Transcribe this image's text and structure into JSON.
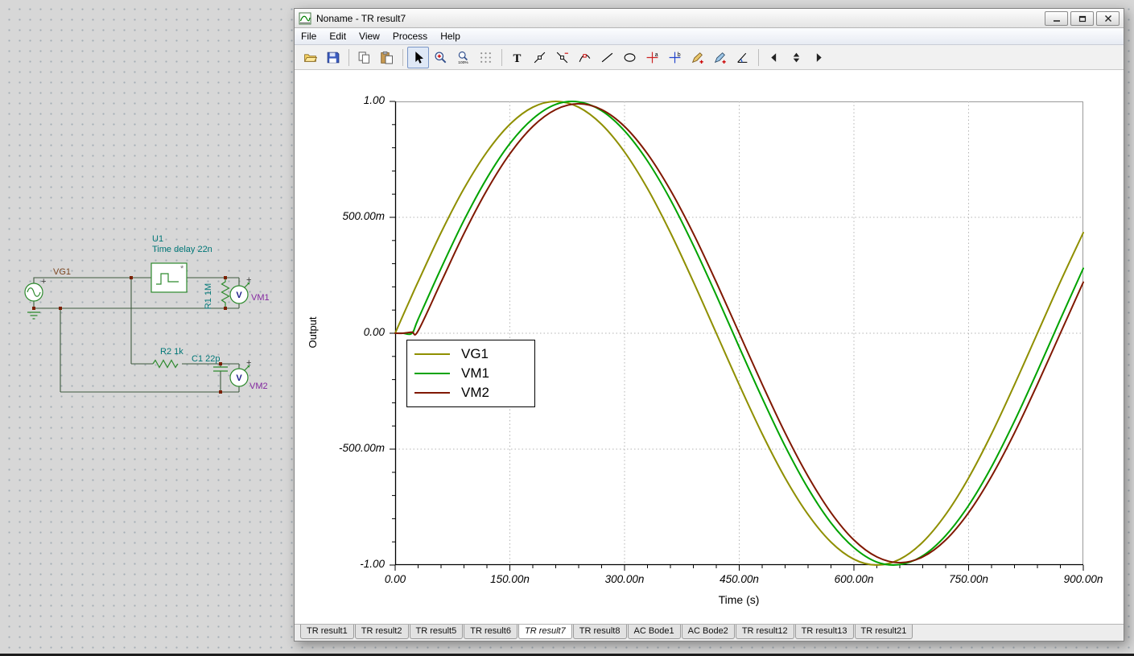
{
  "desktop": {
    "bg_color": "#d7d7d7",
    "grid_dot_color": "#a3adb5"
  },
  "schematic": {
    "wire_color": "#3e5a3e",
    "component_color": "#2d8a2d",
    "labels": {
      "vg1": "VG1",
      "u1_ref": "U1",
      "u1_value": "Time delay 22n",
      "r1": "R1 1M",
      "vm1": "VM1",
      "r2": "R2 1k",
      "c1": "C1 22p",
      "vm2": "VM2",
      "meter_symbol": "V"
    }
  },
  "window": {
    "title": "Noname - TR result7",
    "menu": {
      "items": [
        "File",
        "Edit",
        "View",
        "Process",
        "Help"
      ]
    },
    "toolbar": {
      "buttons": [
        {
          "icon": "open-folder-icon",
          "name": "open"
        },
        {
          "icon": "save-icon",
          "name": "save"
        },
        {
          "sep": true
        },
        {
          "icon": "copy-icon",
          "name": "copy"
        },
        {
          "icon": "paste-icon",
          "name": "paste"
        },
        {
          "sep": true
        },
        {
          "icon": "cursor-icon",
          "name": "select-cursor",
          "active": true
        },
        {
          "icon": "zoom-in-icon",
          "name": "zoom-in"
        },
        {
          "icon": "zoom-100-icon",
          "name": "zoom-100"
        },
        {
          "icon": "grid-icon",
          "name": "toggle-grid"
        },
        {
          "sep": true
        },
        {
          "icon": "text-icon",
          "name": "insert-text"
        },
        {
          "icon": "tangent-icon",
          "name": "tangent-tool"
        },
        {
          "icon": "tangent2-icon",
          "name": "secant-tool"
        },
        {
          "icon": "marker-icon",
          "name": "marker-tool"
        },
        {
          "icon": "line-icon",
          "name": "line-tool"
        },
        {
          "icon": "ellipse-icon",
          "name": "ellipse-tool"
        },
        {
          "icon": "axis-a-icon",
          "name": "cursor-a"
        },
        {
          "icon": "axis-b-icon",
          "name": "cursor-b"
        },
        {
          "icon": "pen-plus-icon",
          "name": "add-curve"
        },
        {
          "icon": "pen-edit-icon",
          "name": "edit-curve"
        },
        {
          "icon": "angle-icon",
          "name": "slope-tool"
        },
        {
          "sep": true
        },
        {
          "icon": "arrow-left-icon",
          "name": "prev-curve"
        },
        {
          "icon": "spinner-icon",
          "name": "curve-spinner"
        },
        {
          "icon": "arrow-right-icon",
          "name": "next-curve"
        }
      ]
    },
    "tabs": {
      "active": "TR result7",
      "items": [
        "TR result1",
        "TR result2",
        "TR result5",
        "TR result6",
        "TR result7",
        "TR result8",
        "AC Bode1",
        "AC Bode2",
        "TR result12",
        "TR result13",
        "TR result21"
      ]
    }
  },
  "chart_data": {
    "type": "line",
    "title": "",
    "xlabel": "Time (s)",
    "ylabel": "Output",
    "xlim_ns": [
      0,
      900
    ],
    "ylim": [
      -1,
      1
    ],
    "grid": "dotted",
    "legend_position": "inside-center-left",
    "x_tick_positions_ns": [
      0,
      150,
      300,
      450,
      600,
      750,
      900
    ],
    "x_tick_labels": [
      "0.00",
      "150.00n",
      "300.00n",
      "450.00n",
      "600.00n",
      "750.00n",
      "900.00n"
    ],
    "y_tick_positions": [
      1,
      0.5,
      0,
      -0.5,
      -1
    ],
    "y_tick_labels": [
      "1.00",
      "500.00m",
      "0.00",
      "-500.00m",
      "-1.00"
    ],
    "minor_x_step_ns": 30,
    "minor_y_step": 0.1,
    "x_ns": [
      0,
      10,
      22,
      30,
      60,
      90,
      120,
      150,
      180,
      210,
      240,
      270,
      300,
      330,
      360,
      390,
      420,
      450,
      480,
      510,
      540,
      570,
      600,
      630,
      660,
      690,
      720,
      750,
      780,
      810,
      840,
      870,
      900
    ],
    "series": [
      {
        "name": "VG1",
        "color": "#8f8f00",
        "values": [
          0,
          0.075,
          0.164,
          0.222,
          0.434,
          0.624,
          0.782,
          0.901,
          0.975,
          1.0,
          0.975,
          0.901,
          0.782,
          0.624,
          0.434,
          0.222,
          0,
          -0.222,
          -0.434,
          -0.624,
          -0.782,
          -0.901,
          -0.975,
          -1.0,
          -0.975,
          -0.901,
          -0.782,
          -0.624,
          -0.434,
          -0.222,
          0,
          0.222,
          0.434
        ]
      },
      {
        "name": "VM1",
        "color": "#00a300",
        "values": [
          0,
          0,
          0,
          0.06,
          0.28,
          0.487,
          0.669,
          0.818,
          0.925,
          0.987,
          0.998,
          0.96,
          0.873,
          0.743,
          0.576,
          0.379,
          0.164,
          -0.06,
          -0.28,
          -0.487,
          -0.669,
          -0.818,
          -0.925,
          -0.987,
          -0.998,
          -0.96,
          -0.873,
          -0.743,
          -0.576,
          -0.379,
          -0.164,
          0.06,
          0.28
        ]
      },
      {
        "name": "VM2",
        "color": "#801800",
        "values": [
          0,
          0,
          0.005,
          0.01,
          0.22,
          0.43,
          0.617,
          0.774,
          0.892,
          0.965,
          0.99,
          0.965,
          0.892,
          0.774,
          0.617,
          0.43,
          0.22,
          0,
          -0.22,
          -0.43,
          -0.617,
          -0.774,
          -0.892,
          -0.965,
          -0.99,
          -0.965,
          -0.892,
          -0.774,
          -0.617,
          -0.43,
          -0.22,
          0,
          0.22
        ]
      }
    ]
  }
}
